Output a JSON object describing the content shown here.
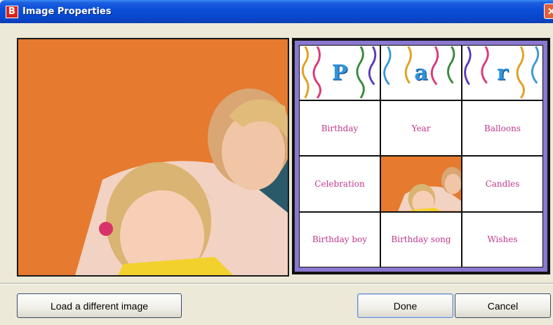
{
  "window": {
    "title": "Image Properties",
    "app_icon_letter": "B",
    "close_glyph": "✕"
  },
  "grid": {
    "header_letters": [
      "P",
      "a",
      "r"
    ],
    "cells": [
      "Birthday",
      "Year",
      "Balloons",
      "Celebration",
      "",
      "Candles",
      "Birthday boy",
      "Birthday song",
      "Wishes"
    ]
  },
  "buttons": {
    "load_label": "Load a different image",
    "done_label": "Done",
    "cancel_label": "Cancel"
  },
  "colors": {
    "accent_purple": "#8b78d0",
    "label_pink": "#c0388a",
    "photo_orange": "#e67a2e"
  }
}
